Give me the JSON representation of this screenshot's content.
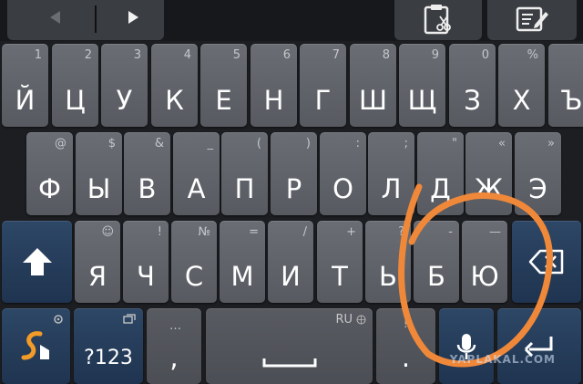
{
  "toolbar": {
    "icons": [
      "arrow-left-icon",
      "arrow-right-icon",
      "clipboard-cut-icon",
      "edit-note-icon"
    ]
  },
  "rows": [
    {
      "keys": [
        {
          "hint": "1",
          "label": "Й"
        },
        {
          "hint": "2",
          "label": "Ц"
        },
        {
          "hint": "3",
          "label": "У"
        },
        {
          "hint": "4",
          "label": "К"
        },
        {
          "hint": "5",
          "label": "Е"
        },
        {
          "hint": "6",
          "label": "Н"
        },
        {
          "hint": "7",
          "label": "Г"
        },
        {
          "hint": "8",
          "label": "Ш"
        },
        {
          "hint": "9",
          "label": "Щ"
        },
        {
          "hint": "0",
          "label": "З"
        },
        {
          "hint": "%",
          "label": "Х"
        },
        {
          "hint": "°",
          "label": "Ъ"
        }
      ]
    },
    {
      "keys": [
        {
          "hint": "@",
          "label": "Ф"
        },
        {
          "hint": "$",
          "label": "Ы"
        },
        {
          "hint": "&",
          "label": "В"
        },
        {
          "hint": "_",
          "label": "А"
        },
        {
          "hint": "(",
          "label": "П"
        },
        {
          "hint": ")",
          "label": "Р"
        },
        {
          "hint": ":",
          "label": "О"
        },
        {
          "hint": ";",
          "label": "Л"
        },
        {
          "hint": "\"",
          "label": "Д"
        },
        {
          "hint": "«",
          "label": "Ж"
        },
        {
          "hint": "»",
          "label": "Э"
        }
      ]
    },
    {
      "keys": [
        {
          "hint": "☺",
          "label": "Я"
        },
        {
          "hint": "!",
          "label": "Ч"
        },
        {
          "hint": "№",
          "label": "С"
        },
        {
          "hint": "=",
          "label": "М"
        },
        {
          "hint": "/",
          "label": "И"
        },
        {
          "hint": "+",
          "label": "Т"
        },
        {
          "hint": "?",
          "label": "Ь"
        },
        {
          "hint": "-",
          "label": "Б"
        },
        {
          "hint": "—",
          "label": "Ю"
        }
      ]
    }
  ],
  "bottom": {
    "symbols_label": "?123",
    "comma_label": ",",
    "comma_hint": "…",
    "language": "RU",
    "period_label": ".",
    "period_hint": "!"
  },
  "watermark": "YAPLAKAL.COM",
  "colors": {
    "annotation": "#f0883a",
    "modifier_key": "#2d4766",
    "key": "#62666c"
  }
}
